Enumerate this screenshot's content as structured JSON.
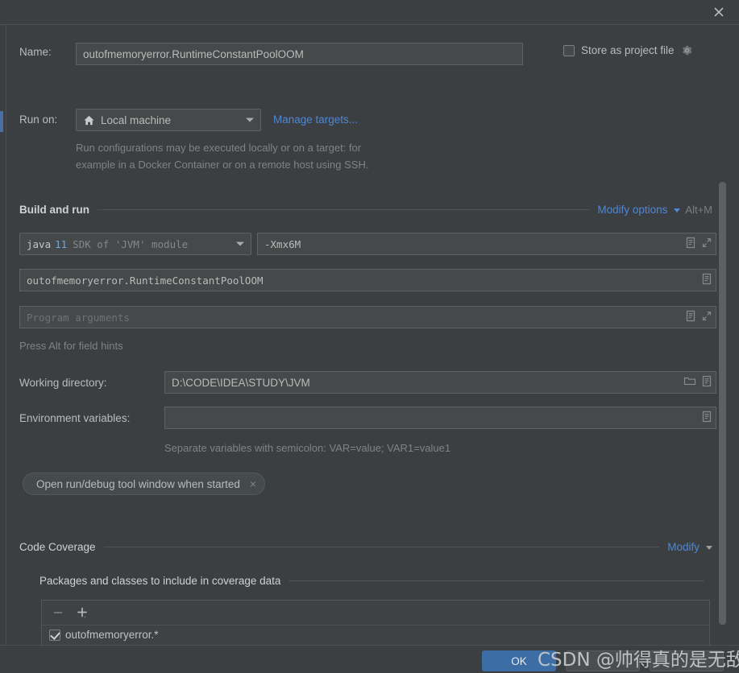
{
  "titlebar": {
    "close_icon": "close-icon"
  },
  "name_row": {
    "label": "Name:",
    "value": "outofmemoryerror.RuntimeConstantPoolOOM"
  },
  "store_as_project_file": {
    "label": "Store as project file",
    "checked": false,
    "gear_icon": "gear-icon"
  },
  "run_on": {
    "label": "Run on:",
    "selected": "Local machine",
    "home_icon": "home-icon",
    "manage_targets_link": "Manage targets...",
    "description_line1": "Run configurations may be executed locally or on a target: for",
    "description_line2": "example in a Docker Container or on a remote host using SSH."
  },
  "build_and_run": {
    "title": "Build and run",
    "modify_options_link": "Modify options",
    "modify_options_shortcut": "Alt+M",
    "jre_combo": {
      "primary": "java 11",
      "secondary": "SDK of 'JVM' module",
      "java_word": "java",
      "version": "11"
    },
    "vm_options": {
      "value": "-Xmx6M",
      "expand_icon": "expand-icon",
      "list_icon": "list-icon"
    },
    "main_class": {
      "value": "outofmemoryerror.RuntimeConstantPoolOOM",
      "list_icon": "list-icon"
    },
    "program_arguments": {
      "value": "",
      "placeholder": "Program arguments",
      "expand_icon": "expand-icon",
      "list_icon": "list-icon"
    },
    "field_hint": "Press Alt for field hints"
  },
  "working_directory": {
    "label": "Working directory:",
    "value": "D:\\CODE\\IDEA\\STUDY\\JVM",
    "folder_icon": "folder-icon",
    "list_icon": "list-icon"
  },
  "environment_variables": {
    "label": "Environment variables:",
    "value": "",
    "list_icon": "list-icon",
    "hint": "Separate variables with semicolon: VAR=value; VAR1=value1"
  },
  "chip": {
    "label": "Open run/debug tool window when started",
    "close_glyph": "×"
  },
  "code_coverage": {
    "title": "Code Coverage",
    "modify_link": "Modify",
    "subsection_title": "Packages and classes to include in coverage data",
    "toolbar": {
      "remove_glyph": "−",
      "add_glyph": "+"
    },
    "items": [
      {
        "label": "outofmemoryerror.*",
        "checked": true
      }
    ]
  },
  "buttons": {
    "ok": "OK",
    "cancel": "",
    "apply": ""
  },
  "watermark": {
    "text": "CSDN @帅得真的是无敌了"
  },
  "colors": {
    "accent_link": "#4d87d6",
    "primary_button": "#3c6ea5",
    "panel_bg": "#3c3f41",
    "field_bg": "#45494a",
    "selection": "#4a6fa5"
  }
}
